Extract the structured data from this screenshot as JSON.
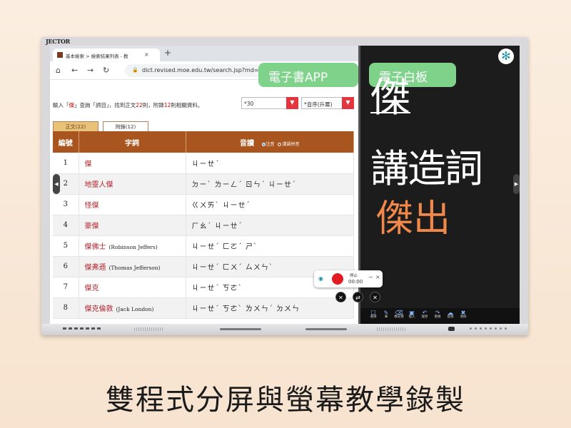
{
  "monitor": {
    "brand": "JECTOR"
  },
  "browser": {
    "tab_title": "基本檢索 > 檢索結果列表 - 教",
    "tab_close": "×",
    "new_tab": "+",
    "url": "dict.revised.moe.edu.tw/search.jsp?md=1&"
  },
  "search": {
    "info_prefix": "輸入「",
    "query": "傑",
    "info_mid1": "」查詢「詞目」，找到正文",
    "main_count": "22",
    "info_mid2": "則，附錄",
    "appendix_count": "12",
    "info_suffix": "則相關資料。",
    "per_page": "*30",
    "sort": "*音序(升冪)"
  },
  "subtabs": {
    "main": "正文(22)",
    "appendix": "附錄(12)"
  },
  "table": {
    "headers": {
      "num": "編號",
      "word": "字詞",
      "pron": "音讀"
    },
    "legend": {
      "zhuyin": "注音",
      "pinyin": "漢語拼音"
    },
    "rows": [
      {
        "num": "1",
        "word": "傑",
        "en": "",
        "pron": "ㄐㄧㄝˊ"
      },
      {
        "num": "2",
        "word": "地靈人傑",
        "en": "",
        "pron": "ㄉㄧˋ ㄌㄧㄥˊ ㄖㄣˊ ㄐㄧㄝˊ"
      },
      {
        "num": "3",
        "word": "怪傑",
        "en": "",
        "pron": "ㄍㄨㄞˋ ㄐㄧㄝˊ"
      },
      {
        "num": "4",
        "word": "豪傑",
        "en": "",
        "pron": "ㄏㄠˊ ㄐㄧㄝˊ"
      },
      {
        "num": "5",
        "word": "傑佛士",
        "en": "(Robinson Jeffers)",
        "pron": "ㄐㄧㄝˊ ㄈㄛˊ ㄕˋ"
      },
      {
        "num": "6",
        "word": "傑弗遜",
        "en": "(Thomas Jefferson)",
        "pron": "ㄐㄧㄝˊ ㄈㄨˊ ㄙㄨㄣˋ"
      },
      {
        "num": "7",
        "word": "傑克",
        "en": "",
        "pron": "ㄐㄧㄝˊ ㄎㄜˋ"
      },
      {
        "num": "8",
        "word": "傑克倫敦",
        "en": "(Jack London)",
        "pron": "ㄐㄧㄝˊ ㄎㄜˋ ㄌㄨㄣˊ ㄉㄨㄣ"
      }
    ]
  },
  "pills": {
    "ebook": "電子書APP",
    "whiteboard": "電子白板"
  },
  "whiteboard": {
    "line1": "傑",
    "line2": "講造詞",
    "line3": "傑出",
    "toolbar": [
      "選擇",
      "筆",
      "橡皮擦",
      "插入",
      "復原",
      "重做",
      "雲端",
      "清除"
    ]
  },
  "recorder": {
    "label": "停止",
    "time": "00:00",
    "minimize": "−"
  },
  "caption": "雙程式分屏與螢幕教學錄製"
}
